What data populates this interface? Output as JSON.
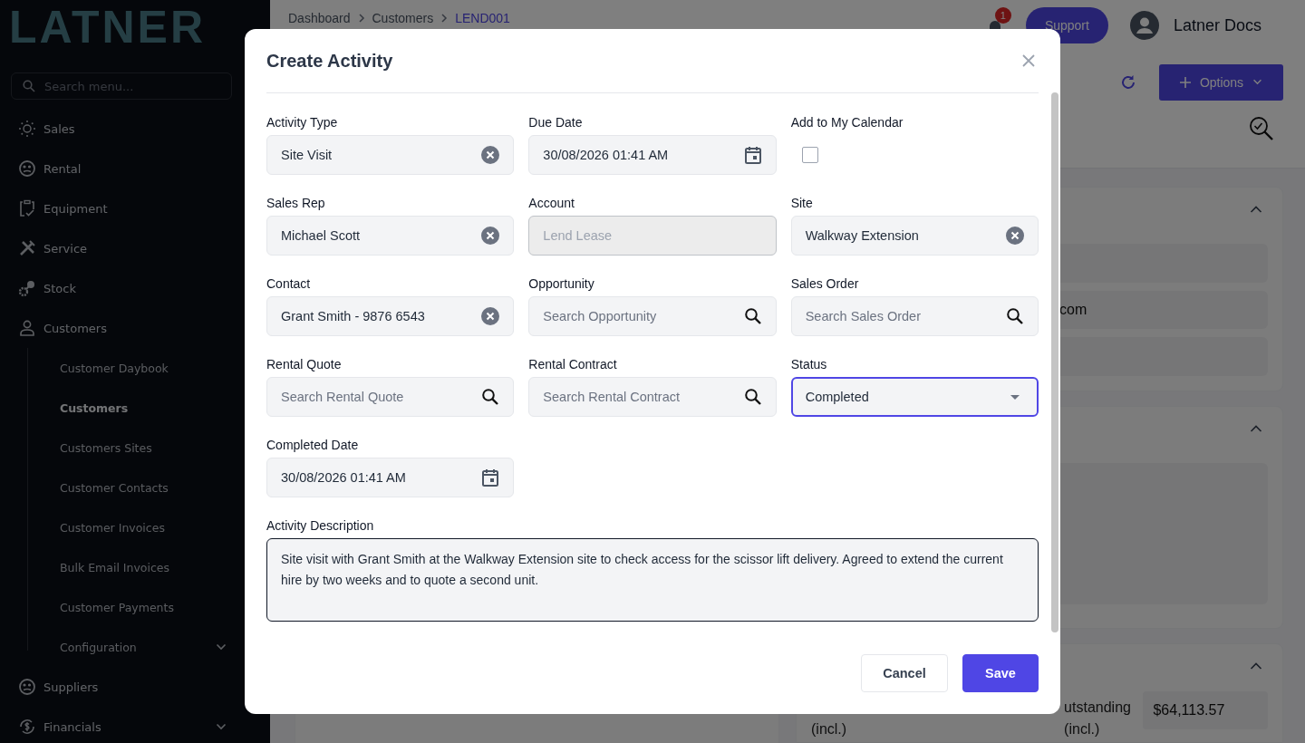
{
  "sidebar": {
    "logo": "LATNER",
    "search": {
      "placeholder": "Search menu..."
    },
    "items": [
      {
        "label": "Sales",
        "expandable": false
      },
      {
        "label": "Rental",
        "expandable": false
      },
      {
        "label": "Equipment",
        "expandable": false
      },
      {
        "label": "Service",
        "expandable": false
      },
      {
        "label": "Stock",
        "expandable": false
      },
      {
        "label": "Customers",
        "expandable": false,
        "children": [
          {
            "label": "Customer Daybook",
            "selected": false,
            "expandable": false
          },
          {
            "label": "Customers",
            "selected": true,
            "expandable": false
          },
          {
            "label": "Customers Sites",
            "selected": false,
            "expandable": false
          },
          {
            "label": "Customer Contacts",
            "selected": false,
            "expandable": false
          },
          {
            "label": "Customer Invoices",
            "selected": false,
            "expandable": false
          },
          {
            "label": "Bulk Email Invoices",
            "selected": false,
            "expandable": false
          },
          {
            "label": "Customer Payments",
            "selected": false,
            "expandable": false
          },
          {
            "label": "Configuration",
            "selected": false,
            "expandable": true
          }
        ]
      },
      {
        "label": "Suppliers",
        "expandable": false
      },
      {
        "label": "Financials",
        "expandable": true
      }
    ]
  },
  "header": {
    "breadcrumb": [
      {
        "label": "Dashboard",
        "current": false
      },
      {
        "label": "Customers",
        "current": false
      },
      {
        "label": "LEND001",
        "current": true
      }
    ],
    "notification_count": "1",
    "support": "Support",
    "user": "Latner Docs"
  },
  "toolbar": {
    "options": "Options"
  },
  "background_panel": {
    "email_fragment": "com",
    "totals": [
      {
        "label": "(incl.)"
      },
      {
        "label": "utstanding",
        "label_2": "(incl.)",
        "value": "$64,113.57"
      }
    ]
  },
  "modal": {
    "title": "Create Activity",
    "fields": [
      {
        "label": "Activity Type",
        "kind": "clearable",
        "value": "Site Visit"
      },
      {
        "label": "Due Date",
        "kind": "date",
        "value": "30/08/2026 01:41 AM"
      },
      {
        "label": "Add to My Calendar",
        "kind": "checkbox",
        "checked": false
      },
      {
        "label": "Sales Rep",
        "kind": "clearable",
        "value": "Michael Scott"
      },
      {
        "label": "Account",
        "kind": "readonly",
        "value": "Lend Lease"
      },
      {
        "label": "Site",
        "kind": "clearable",
        "value": "Walkway Extension"
      },
      {
        "label": "Contact",
        "kind": "clearable",
        "value": "Grant Smith - 9876 6543"
      },
      {
        "label": "Opportunity",
        "kind": "search",
        "placeholder": "Search Opportunity"
      },
      {
        "label": "Sales Order",
        "kind": "search",
        "placeholder": "Search Sales Order"
      },
      {
        "label": "Rental Quote",
        "kind": "search",
        "placeholder": "Search Rental Quote"
      },
      {
        "label": "Rental Contract",
        "kind": "search",
        "placeholder": "Search Rental Contract"
      },
      {
        "label": "Status",
        "kind": "select",
        "value": "Completed",
        "focused": true
      },
      {
        "label": "Completed Date",
        "kind": "date",
        "value": "30/08/2026 01:41 AM"
      }
    ],
    "description": {
      "label": "Activity Description",
      "value": "Site visit with Grant Smith at the Walkway Extension site to check access for the scissor lift delivery. Agreed to extend the current hire by two weeks and to quote a second unit."
    },
    "buttons": [
      {
        "label": "Cancel",
        "kind": "secondary"
      },
      {
        "label": "Save",
        "kind": "primary"
      }
    ]
  }
}
